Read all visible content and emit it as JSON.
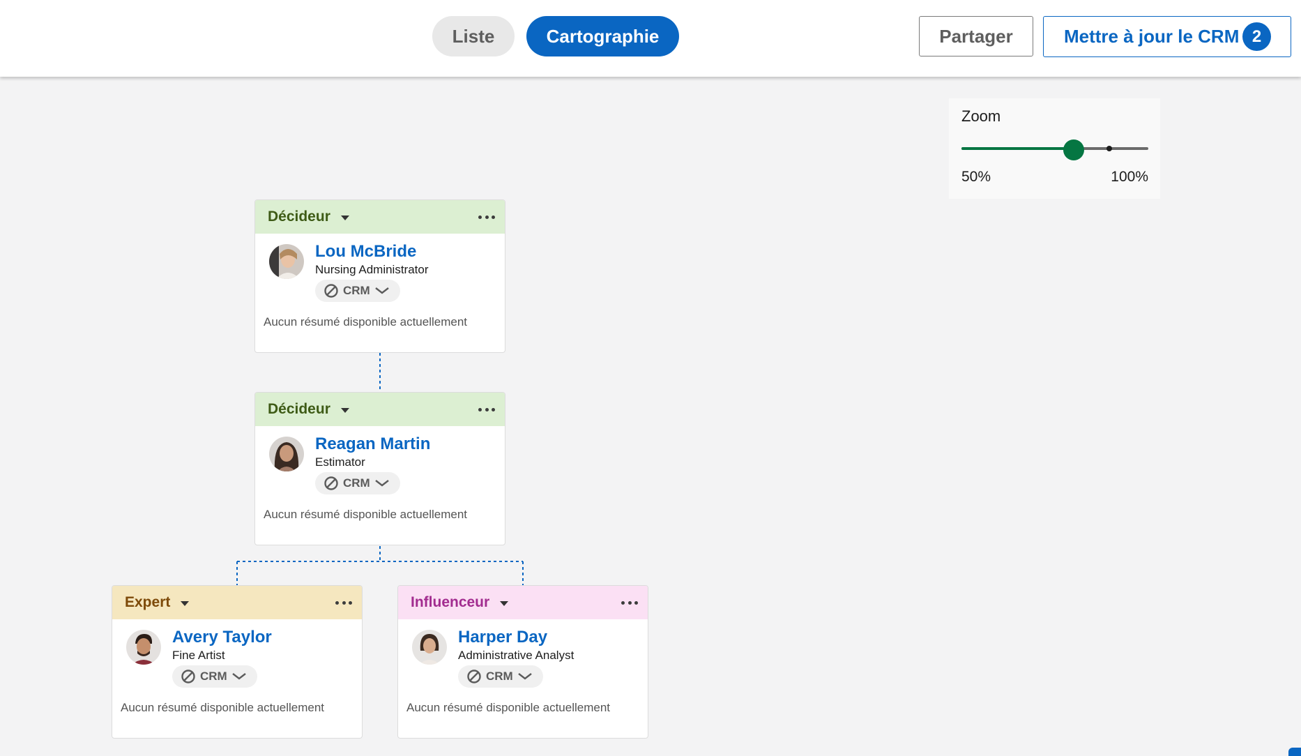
{
  "header": {
    "view_toggle": {
      "list_label": "Liste",
      "map_label": "Cartographie",
      "active": "Cartographie"
    },
    "share_label": "Partager",
    "update_crm_label": "Mettre à jour le CRM",
    "update_crm_count": "2"
  },
  "zoom": {
    "label": "Zoom",
    "min_label": "50%",
    "max_label": "100%",
    "value_fraction": 0.6
  },
  "colors": {
    "brand_blue": "#0a66c2",
    "zoom_green": "#057642",
    "decideur_bg": "#dcefd2",
    "expert_bg": "#f5e7bf",
    "influenceur_bg": "#fbe0f4"
  },
  "cards": [
    {
      "role": "Décideur",
      "name": "Lou McBride",
      "title": "Nursing Administrator",
      "crm_label": "CRM",
      "summary": "Aucun résumé disponible actuellement"
    },
    {
      "role": "Décideur",
      "name": "Reagan Martin",
      "title": "Estimator",
      "crm_label": "CRM",
      "summary": "Aucun résumé disponible actuellement"
    },
    {
      "role": "Expert",
      "name": "Avery Taylor",
      "title": "Fine Artist",
      "crm_label": "CRM",
      "summary": "Aucun résumé disponible actuellement"
    },
    {
      "role": "Influenceur",
      "name": "Harper Day",
      "title": "Administrative Analyst",
      "crm_label": "CRM",
      "summary": "Aucun résumé disponible actuellement"
    }
  ]
}
